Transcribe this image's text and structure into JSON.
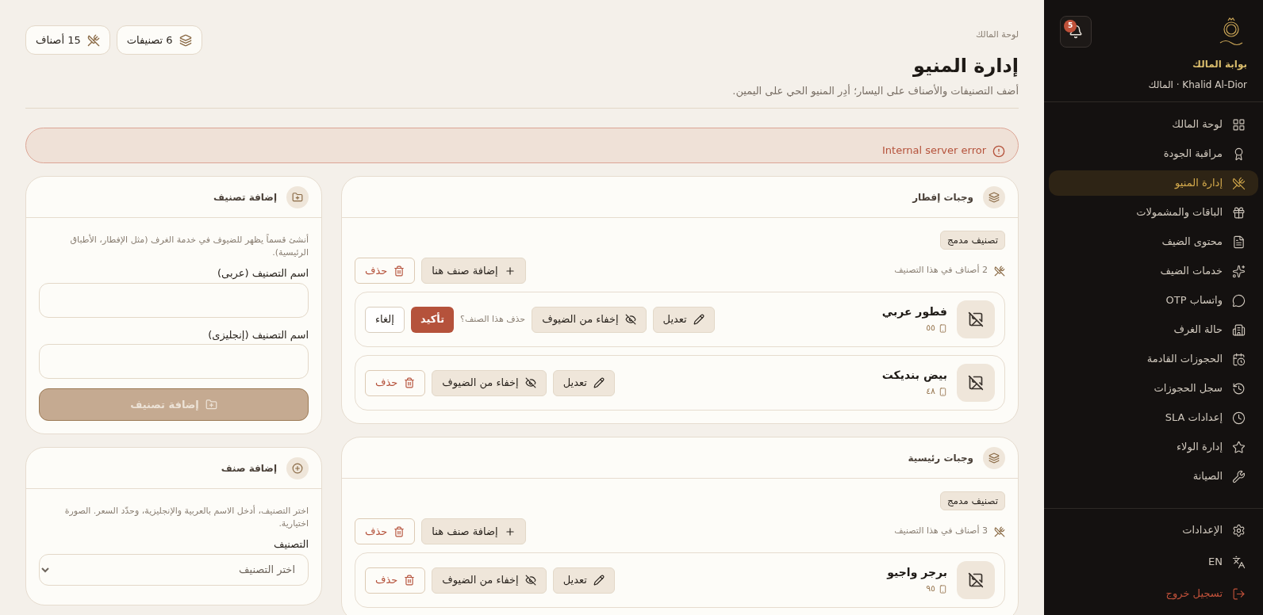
{
  "sidebar": {
    "notifications": {
      "count": "5"
    },
    "portal": "بوابة المالك",
    "user": "Khalid Al-Dior · المالك",
    "items": [
      {
        "label": "لوحة المالك",
        "kind": "grid",
        "selected": false
      },
      {
        "label": "مراقبة الجودة",
        "kind": "award",
        "selected": false
      },
      {
        "label": "إدارة المنيو",
        "kind": "utensils",
        "selected": true
      },
      {
        "label": "الباقات والمشمولات",
        "kind": "gift",
        "selected": false
      },
      {
        "label": "محتوى الضيف",
        "kind": "file",
        "selected": false
      },
      {
        "label": "خدمات الضيف",
        "kind": "sparkles",
        "selected": false
      },
      {
        "label": "واتساب OTP",
        "kind": "chat",
        "selected": false
      },
      {
        "label": "حالة الغرف",
        "kind": "building",
        "selected": false
      },
      {
        "label": "الحجوزات القادمة",
        "kind": "calendar",
        "selected": false
      },
      {
        "label": "سجل الحجوزات",
        "kind": "history",
        "selected": false
      },
      {
        "label": "إعدادات SLA",
        "kind": "clock",
        "selected": false
      },
      {
        "label": "إدارة الولاء",
        "kind": "star",
        "selected": false
      },
      {
        "label": "الصيانة",
        "kind": "wrench",
        "selected": false
      }
    ],
    "footer": [
      {
        "label": "الإعدادات",
        "kind": "settings"
      },
      {
        "label": "EN",
        "kind": "language"
      },
      {
        "label": "تسجيل خروج",
        "kind": "logout"
      }
    ]
  },
  "header": {
    "breadcrumb": "لوحة المالك",
    "title": "إدارة المنيو",
    "subtitle": "أضف التصنيفات والأصناف على اليسار؛ أدِر المنيو الحي على اليمين.",
    "stats": [
      {
        "label": "6 تصنيفات",
        "kind": "layers"
      },
      {
        "label": "15 أصناف",
        "kind": "utensils"
      }
    ]
  },
  "error": "Internal server error",
  "categories": [
    {
      "title": "وجبات إفطار",
      "badge": "تصنيف مدمج",
      "count": "2 أصناف في هذا التصنيف",
      "add_button": "إضافة صنف هنا",
      "delete_button": "حذف",
      "items": [
        {
          "name": "فطور عربي",
          "price": "٥٥",
          "edit": "تعديل",
          "hide": "إخفاء من الضيوف",
          "confirming": true,
          "confirm_question": "حذف هذا الصنف؟",
          "confirm": "تأكيد",
          "cancel": "إلغاء"
        },
        {
          "name": "بيض بنديكت",
          "price": "٤٨",
          "edit": "تعديل",
          "hide": "إخفاء من الضيوف",
          "confirming": false,
          "delete": "حذف"
        }
      ]
    },
    {
      "title": "وجبات رئيسية",
      "badge": "تصنيف مدمج",
      "count": "3 أصناف في هذا التصنيف",
      "add_button": "إضافة صنف هنا",
      "delete_button": "حذف",
      "items": [
        {
          "name": "برجر واجيو",
          "price": "٩٥",
          "edit": "تعديل",
          "hide": "إخفاء من الضيوف",
          "confirming": false,
          "delete": "حذف"
        }
      ]
    }
  ],
  "forms": [
    {
      "title": "إضافة تصنيف",
      "kind": "category",
      "description": "أنشئ قسماً يظهر للضيوف في خدمة الغرف (مثل الإفطار، الأطباق الرئيسية).",
      "fields": [
        {
          "label": "اسم التصنيف (عربى)",
          "kind": "text"
        },
        {
          "label": "اسم التصنيف (إنجليزى)",
          "kind": "text"
        }
      ],
      "submit": {
        "label": "إضافة تصنيف",
        "disabled": true
      }
    },
    {
      "title": "إضافة صنف",
      "kind": "item",
      "description": "اختر التصنيف، أدخل الاسم بالعربية والإنجليزية، وحدّد السعر. الصورة اختيارية.",
      "fields": [
        {
          "label": "التصنيف",
          "kind": "select",
          "placeholder": "اختر التصنيف"
        }
      ]
    }
  ]
}
